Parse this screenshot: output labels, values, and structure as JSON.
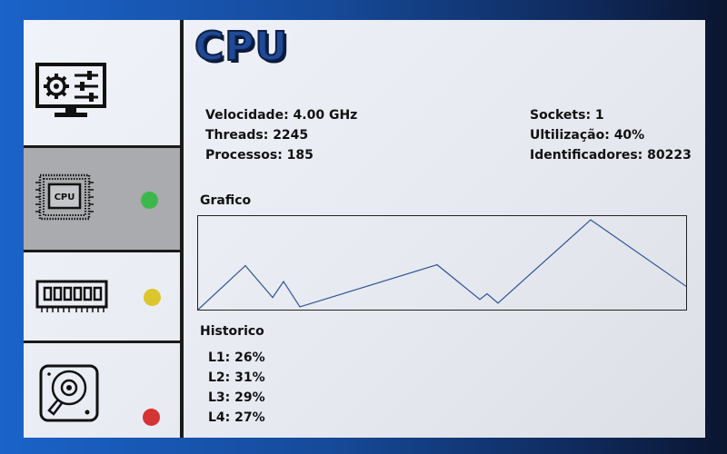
{
  "header": {
    "title": "CPU"
  },
  "sidebar": {
    "items": [
      {
        "icon": "settings-monitor-icon"
      },
      {
        "icon": "cpu-chip-icon",
        "chip_label": "CPU",
        "status_color": "#3cb84a"
      },
      {
        "icon": "ram-module-icon",
        "status_color": "#dcc62e"
      },
      {
        "icon": "hard-disk-icon",
        "status_color": "#d63434"
      }
    ]
  },
  "info": {
    "velocidade": "Velocidade: 4.00 GHz",
    "threads": "Threads: 2245",
    "processos": "Processos: 185",
    "sockets": "Sockets: 1",
    "utilizacao": "Ultilização: 40%",
    "identificadores": "Identificadores: 80223"
  },
  "graph": {
    "label": "Grafico",
    "line_color": "#2f5597",
    "chart_data": {
      "type": "line",
      "values": [
        0,
        47,
        13,
        30,
        3,
        48,
        11,
        17,
        7,
        96,
        25
      ]
    }
  },
  "historico": {
    "label": "Historico",
    "rows": [
      "L1: 26%",
      "L2: 31%",
      "L3: 29%",
      "L4: 27%"
    ]
  }
}
